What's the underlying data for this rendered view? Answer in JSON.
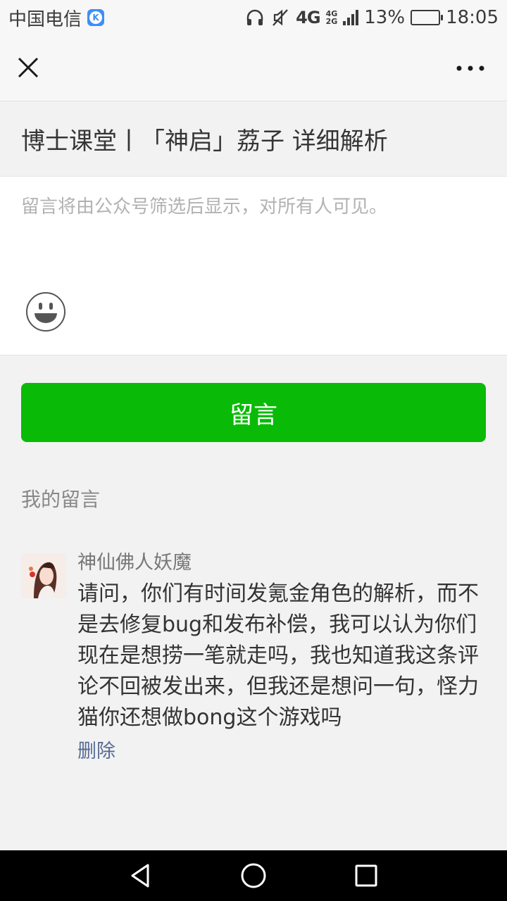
{
  "status_bar": {
    "carrier": "中国电信",
    "network": "4G",
    "network_stack_top": "4G",
    "network_stack_bottom": "2G",
    "battery_percent": "13%",
    "battery_level": 0.13,
    "time": "18:05"
  },
  "nav": {
    "close_icon": "close-icon",
    "more_icon": "more-icon"
  },
  "article": {
    "title": "博士课堂丨「神启」荔子 详细解析"
  },
  "comment_input": {
    "placeholder": "留言将由公众号筛选后显示，对所有人可见。",
    "value": ""
  },
  "submit": {
    "label": "留言",
    "color": "#09bb07"
  },
  "my_comments": {
    "section_title": "我的留言",
    "items": [
      {
        "nickname": "神仙佛人妖魔",
        "text": "请问，你们有时间发氪金角色的解析，而不是去修复bug和发布补偿，我可以认为你们现在是想捞一笔就走吗，我也知道我这条评论不回被发出来，但我还是想问一句，怪力猫你还想做bong这个游戏吗",
        "delete_label": "删除"
      }
    ]
  },
  "colors": {
    "link": "#576b95",
    "background": "#f2f2f2"
  }
}
